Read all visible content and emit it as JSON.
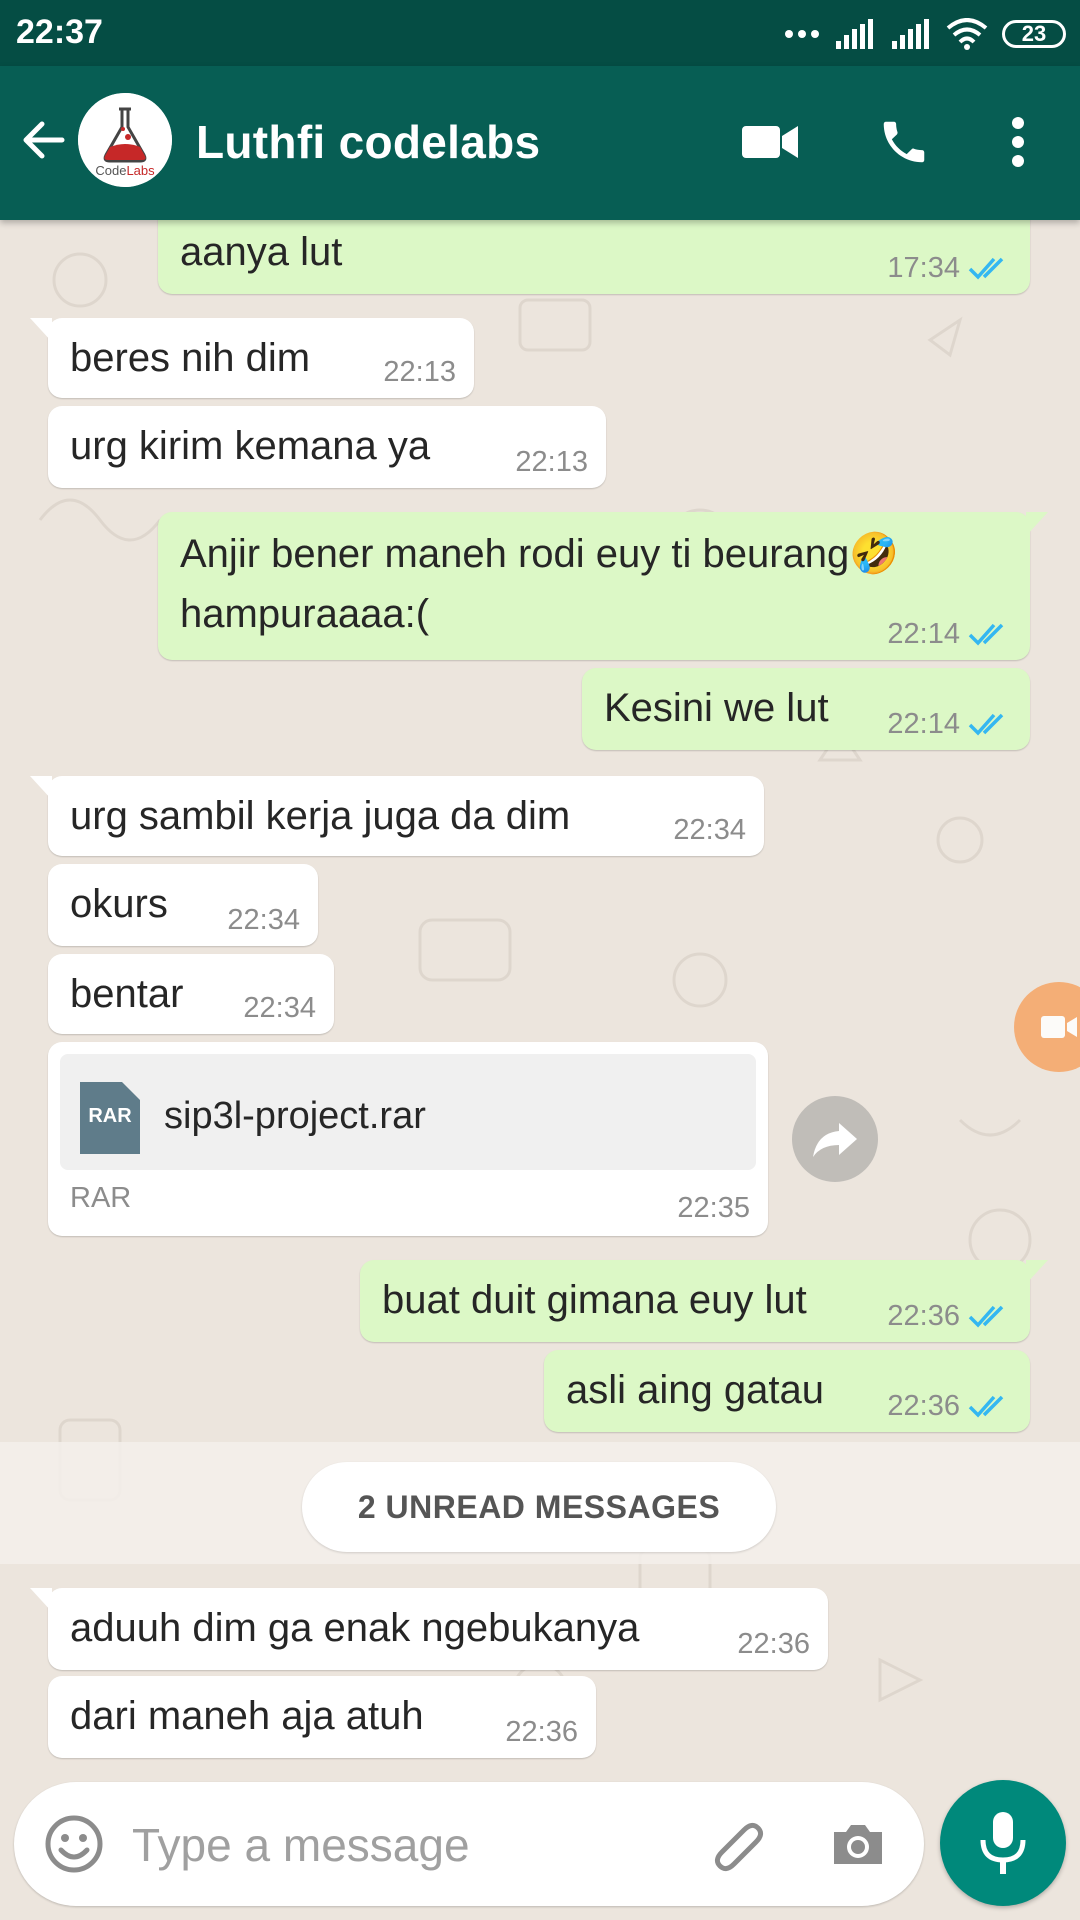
{
  "status_bar": {
    "time": "22:37",
    "battery": "23"
  },
  "header": {
    "contact_name": "Luthfi codelabs",
    "avatar_logo_text": "CodeLabs"
  },
  "messages": [
    {
      "text": "aanya lut",
      "time": "17:34"
    },
    {
      "text": "beres nih dim",
      "time": "22:13"
    },
    {
      "text": "urg kirim kemana ya",
      "time": "22:13"
    },
    {
      "text": "Anjir bener maneh rodi euy ti beurang🤣\nhampuraaaa:(",
      "time": "22:14"
    },
    {
      "text": "Kesini we lut",
      "time": "22:14"
    },
    {
      "text": "urg sambil kerja juga da dim",
      "time": "22:34"
    },
    {
      "text": "okurs",
      "time": "22:34"
    },
    {
      "text": "bentar",
      "time": "22:34"
    },
    {
      "file_name": "sip3l-project.rar",
      "file_icon_label": "RAR",
      "file_type": "RAR",
      "time": "22:35"
    },
    {
      "text": "buat duit gimana euy lut",
      "time": "22:36"
    },
    {
      "text": "asli aing gatau",
      "time": "22:36"
    },
    {
      "text": "aduuh dim ga enak ngebukanya",
      "time": "22:36"
    },
    {
      "text": "dari maneh aja atuh",
      "time": "22:36"
    }
  ],
  "unread_banner": "2 UNREAD MESSAGES",
  "composer": {
    "placeholder": "Type a message"
  },
  "colors": {
    "header": "#075e54",
    "status_bar": "#054d44",
    "outgoing_bubble": "#dcf8c6",
    "incoming_bubble": "#ffffff",
    "read_ticks": "#34b7f1",
    "mic_button": "#00897b"
  },
  "icons": [
    "back-arrow-icon",
    "video-call-icon",
    "phone-icon",
    "more-vert-icon",
    "double-check-icon",
    "file-rar-icon",
    "forward-icon",
    "emoji-icon",
    "attach-icon",
    "camera-icon",
    "mic-icon"
  ]
}
